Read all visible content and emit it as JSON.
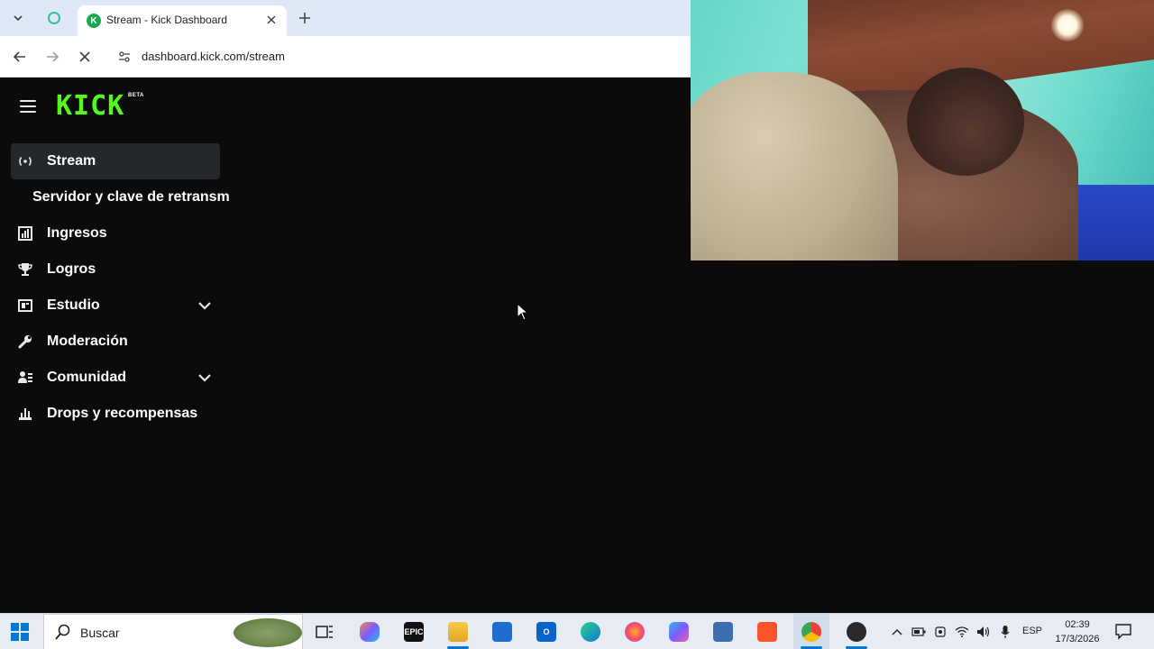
{
  "browser": {
    "tab_title": "Stream - Kick Dashboard",
    "url": "dashboard.kick.com/stream"
  },
  "logo": {
    "text": "KICK",
    "badge": "BETA",
    "color": "#53fc18"
  },
  "sidebar": {
    "items": [
      {
        "label": "Stream",
        "icon": "broadcast-icon",
        "active": true
      },
      {
        "label": "Servidor y clave de retransm",
        "sub": true
      },
      {
        "label": "Ingresos",
        "icon": "chart-icon"
      },
      {
        "label": "Logros",
        "icon": "trophy-icon"
      },
      {
        "label": "Estudio",
        "icon": "studio-icon",
        "expandable": true
      },
      {
        "label": "Moderación",
        "icon": "wrench-icon"
      },
      {
        "label": "Comunidad",
        "icon": "users-icon",
        "expandable": true
      },
      {
        "label": "Drops y recompensas",
        "icon": "drops-icon"
      }
    ]
  },
  "taskbar": {
    "search_placeholder": "Buscar",
    "language": "ESP",
    "time": "02:39",
    "date": "17/3/2026",
    "apps": [
      "task-view-icon",
      "copilot-icon",
      "epic-games-icon",
      "file-explorer-icon",
      "microsoft-store-icon",
      "outlook-icon",
      "edge-icon",
      "firefox-icon",
      "m365-icon",
      "network-app-icon",
      "brave-icon",
      "chrome-icon",
      "obs-icon"
    ]
  }
}
